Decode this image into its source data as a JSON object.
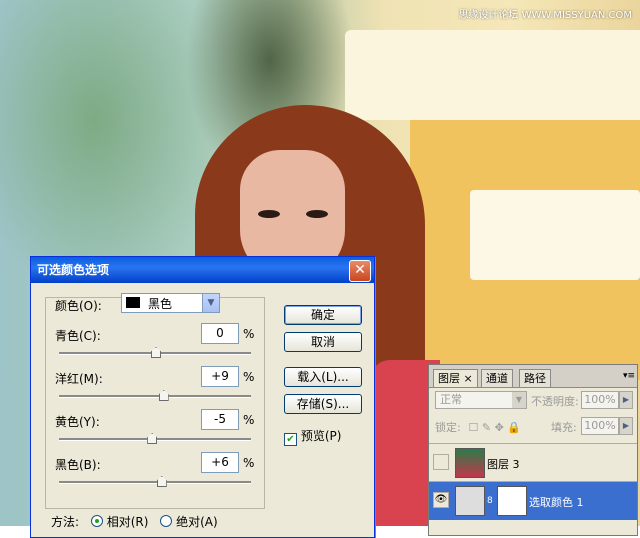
{
  "watermark": "思缘设计论坛 WWW.MISSYUAN.COM",
  "dialog": {
    "title": "可选颜色选项",
    "colors_label": "颜色(O):",
    "color_value": "黑色",
    "channels": [
      {
        "label": "青色(C):",
        "value": "0",
        "percent": 50
      },
      {
        "label": "洋红(M):",
        "value": "+9",
        "percent": 54
      },
      {
        "label": "黄色(Y):",
        "value": "-5",
        "percent": 48
      },
      {
        "label": "黑色(B):",
        "value": "+6",
        "percent": 53
      }
    ],
    "pct": "%",
    "buttons": {
      "ok": "确定",
      "cancel": "取消",
      "load": "载入(L)...",
      "save": "存储(S)..."
    },
    "preview": {
      "label": "预览(P)",
      "checked": true
    },
    "method": {
      "label": "方法:",
      "relative": "相对(R)",
      "absolute": "绝对(A)",
      "selected": "relative"
    }
  },
  "layers_panel": {
    "tabs": [
      "图层",
      "通道",
      "路径"
    ],
    "tab_close": "×",
    "blend_mode": "正常",
    "opacity_label": "不透明度:",
    "opacity": "100%",
    "lock_label": "锁定:",
    "fill_label": "填充:",
    "fill": "100%",
    "layers": [
      {
        "name": "图层 3",
        "selected": false
      },
      {
        "name": "选取颜色 1",
        "selected": true
      }
    ]
  },
  "colors": {
    "selected_layer": "#3a6fcf",
    "title_bar": "#0a5fe0"
  }
}
